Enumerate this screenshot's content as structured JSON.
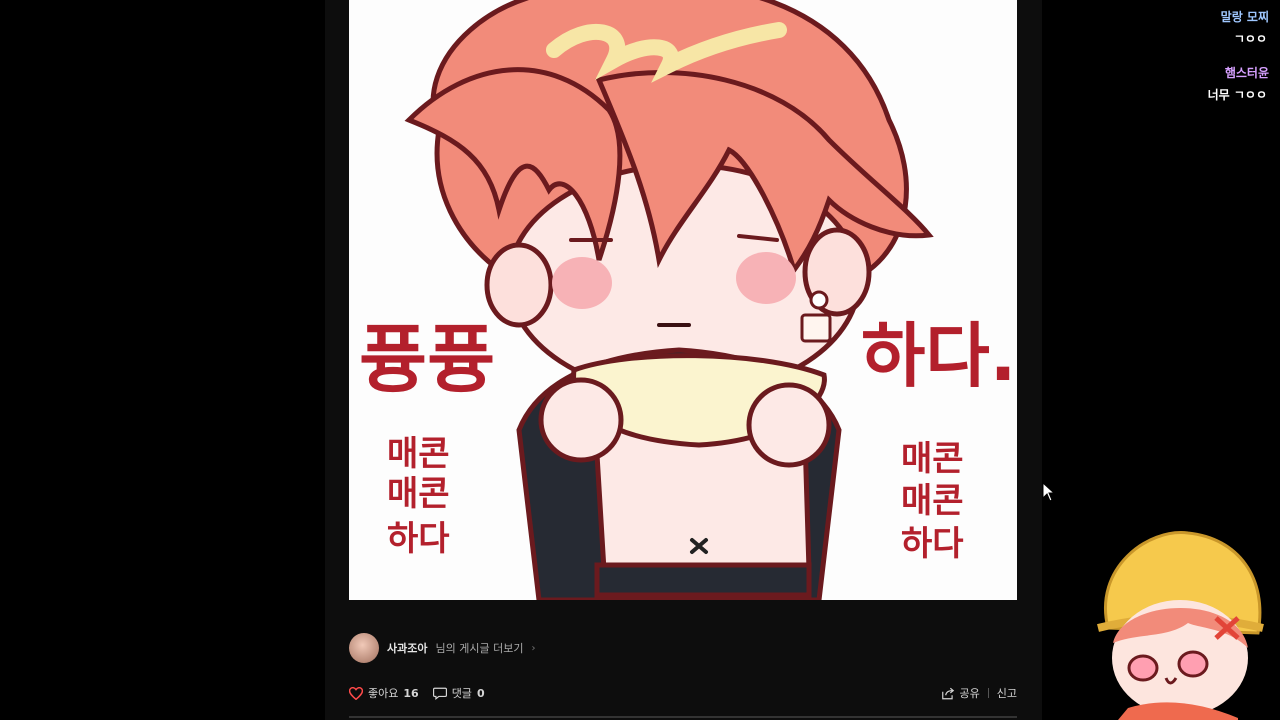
{
  "artwork": {
    "left_text": "퓽퓽",
    "right_text": "하다.",
    "small_text_left": [
      "매콘",
      "매콘",
      "하다"
    ],
    "small_text_right": [
      "매콘",
      "매콘",
      "하다"
    ]
  },
  "post": {
    "author_name": "사과조아",
    "author_suffix": "님의 게시글 더보기",
    "author_chevron": "›",
    "like_label": "좋아요",
    "like_count": "16",
    "comment_label": "댓글",
    "comment_count": "0",
    "share_label": "공유",
    "report_label": "신고"
  },
  "chat": [
    {
      "user": "말랑 모찌",
      "text": "ㄱㅇㅇ"
    },
    {
      "user": "햄스터윤",
      "text": "너무 ㄱㅇㅇ"
    }
  ],
  "icons": {
    "like": "heart-icon",
    "comment": "speech-bubble-icon",
    "share": "share-icon"
  },
  "colors": {
    "like_heart": "#ff4a4a",
    "chat_user_1": "#9fc7ff",
    "chat_user_2": "#d6a0ff",
    "art_text": "#b3202c",
    "hair": "#f28b7a"
  }
}
